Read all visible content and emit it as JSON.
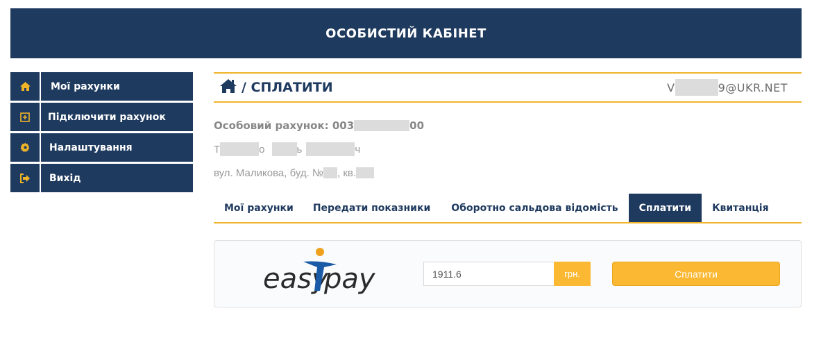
{
  "header": {
    "title": "ОСОБИСТИЙ КАБІНЕТ"
  },
  "sidebar": {
    "items": [
      {
        "label": "Мої рахунки",
        "icon": "home-icon"
      },
      {
        "label": "Підключити рахунок",
        "icon": "plus-square-icon"
      },
      {
        "label": "Налаштування",
        "icon": "gear-icon"
      },
      {
        "label": "Вихід",
        "icon": "sign-out-icon"
      }
    ]
  },
  "breadcrumb": {
    "text": "/ СПЛАТИТИ",
    "email_start": "V",
    "email_end": "9@UKR.NET"
  },
  "account": {
    "number_prefix": "Особовий рахунок: 003",
    "number_suffix": "00",
    "name_parts": [
      "Т",
      "о",
      "ь",
      "ч"
    ],
    "address_prefix": "вул. Маликова, буд. №",
    "address_mid": ", кв."
  },
  "tabs": [
    {
      "label": "Мої рахунки",
      "active": false
    },
    {
      "label": "Передати показники",
      "active": false
    },
    {
      "label": "Оборотно сальдова відомість",
      "active": false
    },
    {
      "label": "Сплатити",
      "active": true
    },
    {
      "label": "Квитанція",
      "active": false
    }
  ],
  "payment": {
    "logo_text_left": "easy",
    "logo_text_right": "pay",
    "amount": "1911.6",
    "currency": "грн.",
    "button_label": "Сплатити"
  },
  "colors": {
    "navy": "#1f3a5f",
    "accent": "#f0b429",
    "button": "#fbb833"
  }
}
